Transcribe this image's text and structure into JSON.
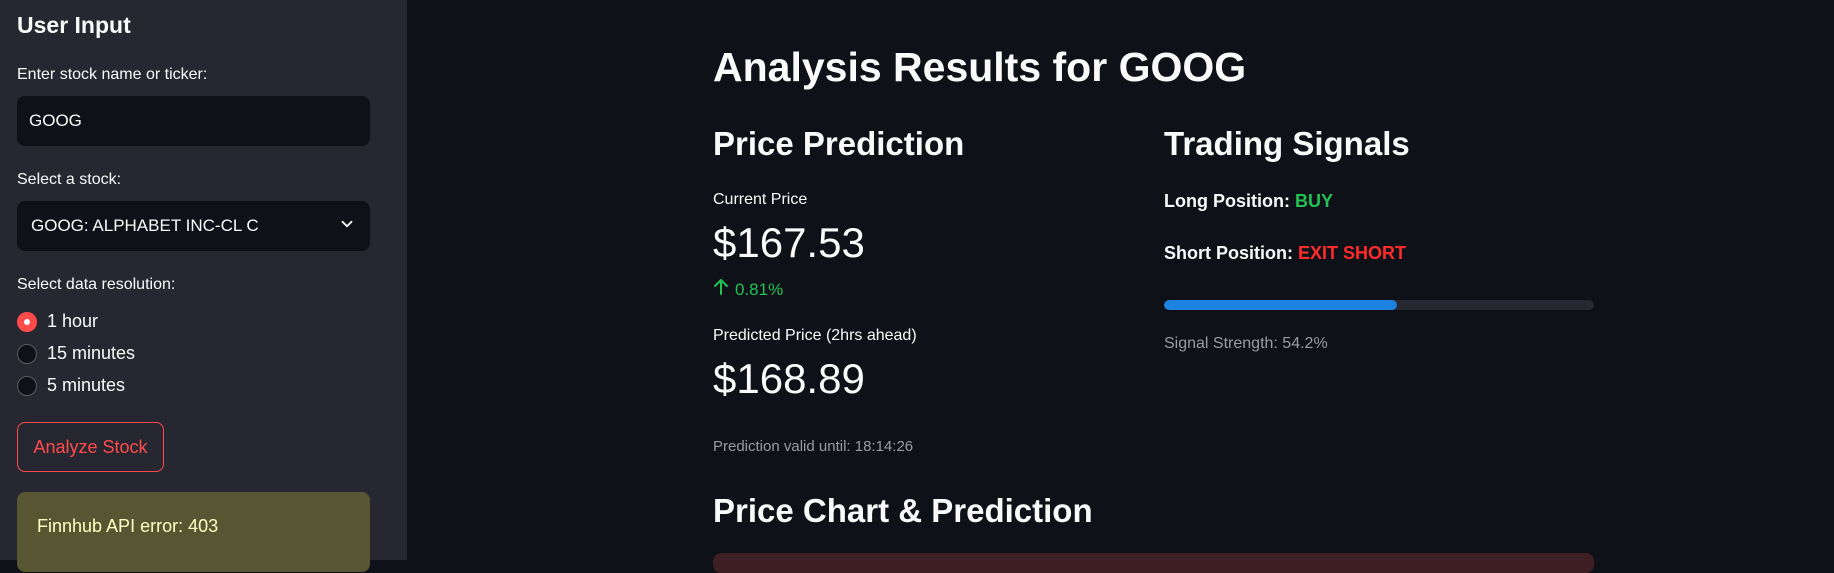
{
  "sidebar": {
    "title": "User Input",
    "stock_input_label": "Enter stock name or ticker:",
    "stock_input_value": "GOOG",
    "select_label": "Select a stock:",
    "select_value": "GOOG: ALPHABET INC-CL C",
    "resolution_label": "Select data resolution:",
    "resolution_options": [
      {
        "label": "1 hour",
        "selected": true
      },
      {
        "label": "15 minutes",
        "selected": false
      },
      {
        "label": "5 minutes",
        "selected": false
      }
    ],
    "analyze_button": "Analyze Stock",
    "alert_text": "Finnhub API error: 403"
  },
  "main": {
    "title": "Analysis Results for GOOG",
    "price_prediction": {
      "heading": "Price Prediction",
      "current_label": "Current Price",
      "current_value": "$167.53",
      "delta": "0.81%",
      "predicted_label": "Predicted Price (2hrs ahead)",
      "predicted_value": "$168.89",
      "valid_until": "Prediction valid until: 18:14:26"
    },
    "trading_signals": {
      "heading": "Trading Signals",
      "long_label": "Long Position:",
      "long_value": "BUY",
      "short_label": "Short Position:",
      "short_value": "EXIT SHORT",
      "strength_percent": 54.2,
      "strength_text": "Signal Strength: 54.2%"
    },
    "chart_heading": "Price Chart & Prediction"
  },
  "colors": {
    "accent": "#ff4b4b",
    "positive": "#21c354",
    "negative": "#ff2b2b",
    "progress": "#1c83e1",
    "warning_bg": "#585632"
  }
}
